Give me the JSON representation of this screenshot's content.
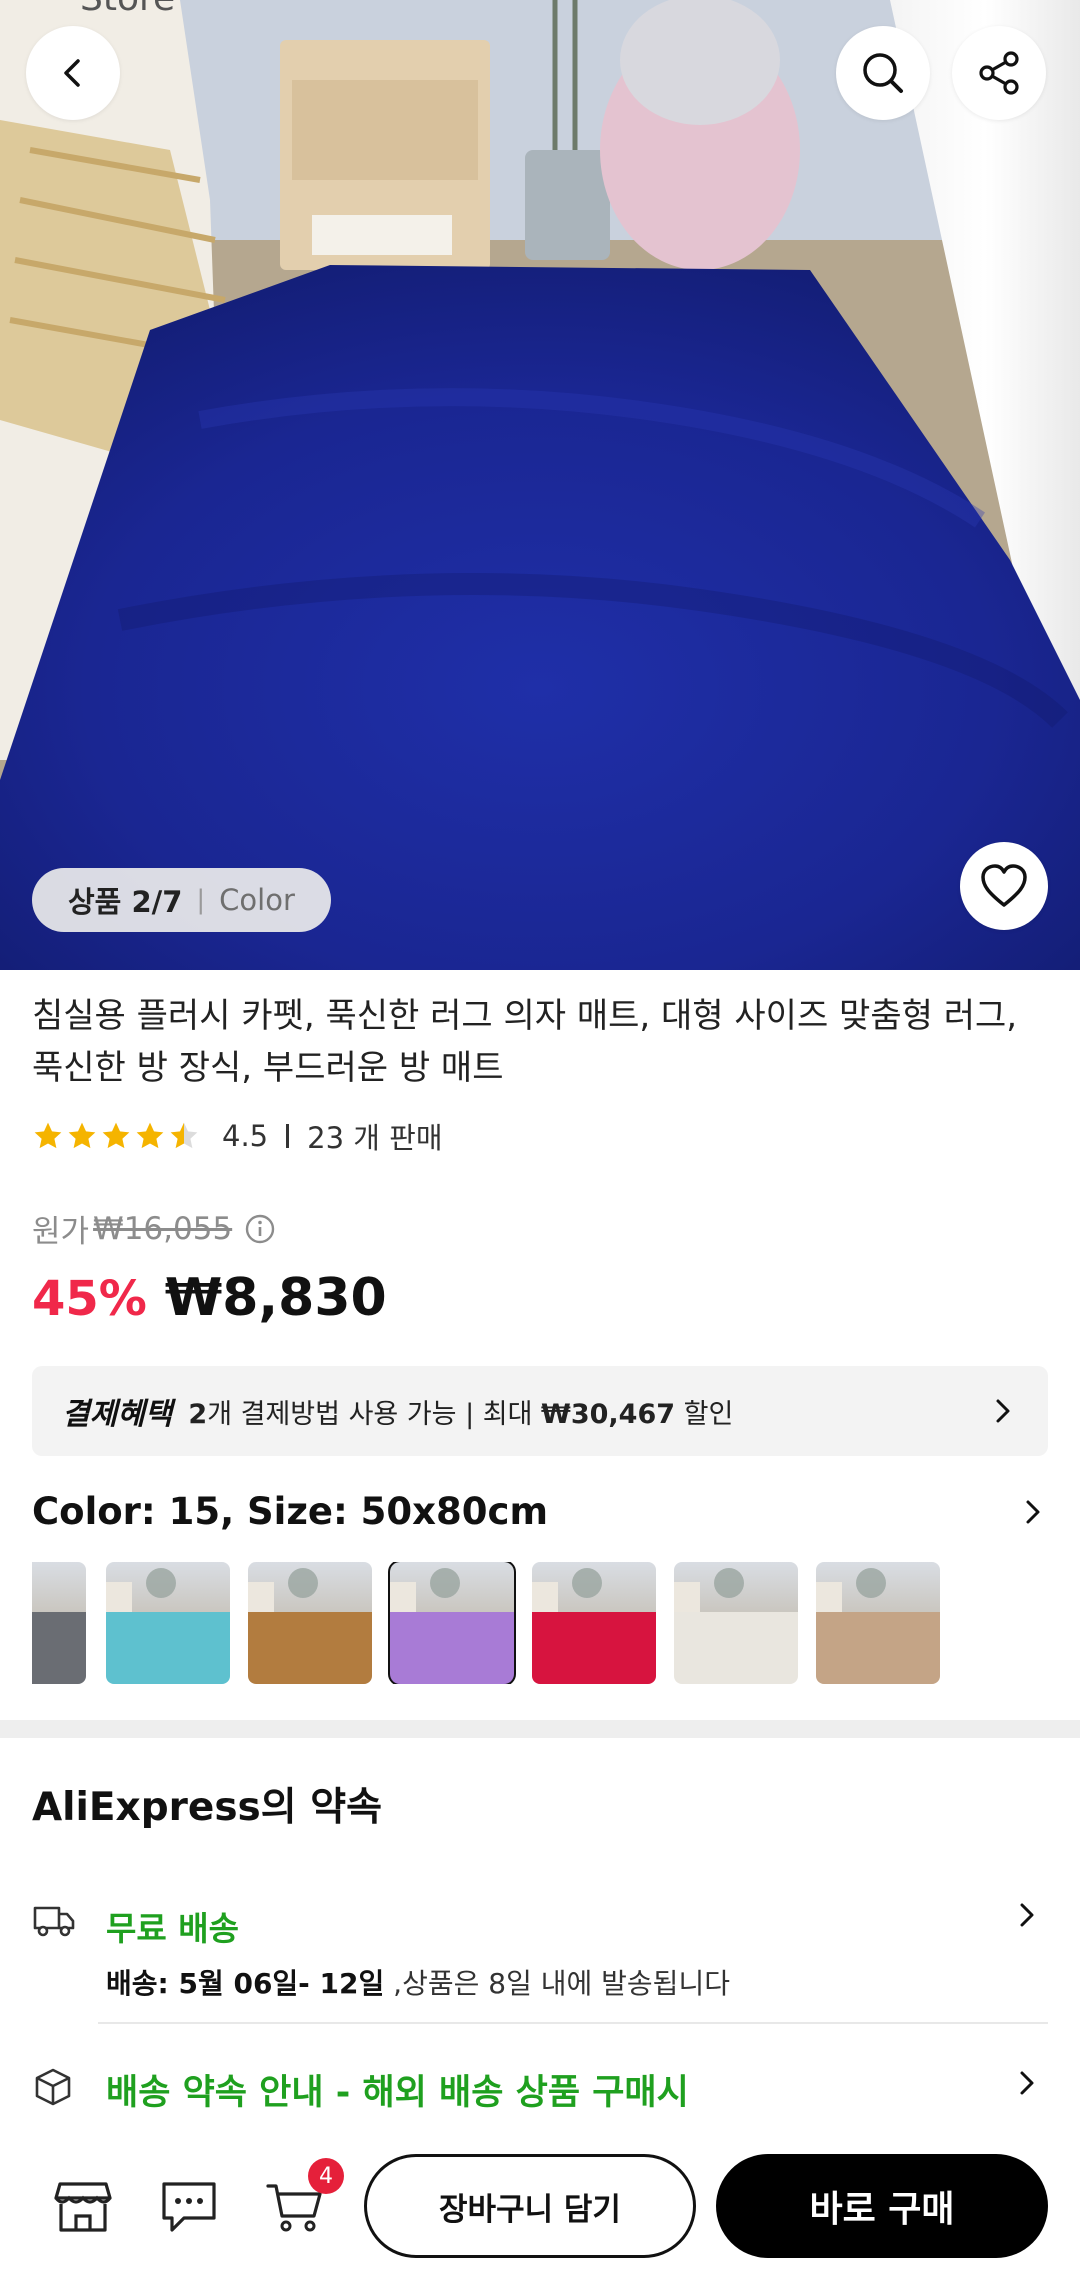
{
  "hero": {
    "pager_current": "상품 2/7",
    "pager_label": "Color"
  },
  "product": {
    "title": "침실용 플러시 카펫, 푹신한 러그 의자 매트, 대형 사이즈 맞춤형 러그, 푹신한 방 장식, 부드러운 방 매트",
    "rating": "4.5",
    "sold": "23 개 판매",
    "rating_stars": 4.5
  },
  "price": {
    "orig_label": "원가",
    "original": "₩16,055",
    "discount": "45%",
    "current": "₩8,830"
  },
  "benefit": {
    "tag": "결제혜택",
    "count": "2",
    "text_mid": "개 결제방법 사용 가능 | 최대 ",
    "max_amount": "₩30,467",
    "text_end": " 할인"
  },
  "variant": {
    "label": "Color: 15, Size: 50x80cm",
    "thumbnails": [
      {
        "color": "#6a6d73"
      },
      {
        "color": "#5ec1cf"
      },
      {
        "color": "#b27c3f"
      },
      {
        "color": "#a87bd6",
        "selected": true
      },
      {
        "color": "#d7143f"
      },
      {
        "color": "#e9e6df"
      },
      {
        "color": "#c4a486"
      }
    ]
  },
  "promise": {
    "title": "AliExpress의 약속",
    "free_shipping": "무료 배송",
    "ship_label": "배송: 5월 06일- 12일",
    "ship_note": " ,상품은 8일 내에 발송됩니다",
    "guide": "배송 약속 안내 - 해외 배송 상품 구매시"
  },
  "bottom": {
    "cart_count": "4",
    "add_to_cart": "장바구니 담기",
    "buy_now": "바로 구매"
  },
  "colors": {
    "accent_red": "#f0284a",
    "green": "#1fa01f",
    "rug_blue": "#1d2a9a"
  }
}
